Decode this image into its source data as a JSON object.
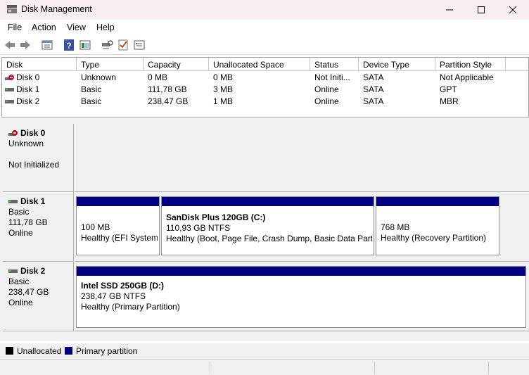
{
  "window": {
    "title": "Disk Management"
  },
  "menu": [
    "File",
    "Action",
    "View",
    "Help"
  ],
  "toolbar": [
    "back-icon",
    "forward-icon",
    "properties-icon",
    "help-icon",
    "view-icon",
    "rescan-icon",
    "check-icon",
    "settings-icon"
  ],
  "list": {
    "columns": [
      "Disk",
      "Type",
      "Capacity",
      "Unallocated Space",
      "Status",
      "Device Type",
      "Partition Style"
    ],
    "rows": [
      {
        "disk": "Disk 0",
        "type": "Unknown",
        "capacity": "0 MB",
        "unallocated": "0 MB",
        "status": "Not Initi...",
        "device": "SATA",
        "style": "Not Applicable",
        "icon": "disk-error-icon"
      },
      {
        "disk": "Disk 1",
        "type": "Basic",
        "capacity": "111,78 GB",
        "unallocated": "3 MB",
        "status": "Online",
        "device": "SATA",
        "style": "GPT",
        "icon": "disk-icon"
      },
      {
        "disk": "Disk 2",
        "type": "Basic",
        "capacity": "238,47 GB",
        "unallocated": "1 MB",
        "status": "Online",
        "device": "SATA",
        "style": "MBR",
        "icon": "disk-icon"
      }
    ]
  },
  "disks": [
    {
      "name": "Disk 0",
      "lines": [
        "Unknown",
        "",
        "Not Initialized"
      ],
      "partitions": []
    },
    {
      "name": "Disk 1",
      "lines": [
        "Basic",
        "111,78 GB",
        "Online"
      ],
      "partitions": [
        {
          "title": "",
          "size": "100 MB",
          "status": "Healthy (EFI System"
        },
        {
          "title": "SanDisk Plus 120GB  (C:)",
          "size": "110,93 GB NTFS",
          "status": "Healthy (Boot, Page File, Crash Dump, Basic Data Partit"
        },
        {
          "title": "",
          "size": "768 MB",
          "status": "Healthy (Recovery Partition)"
        }
      ]
    },
    {
      "name": "Disk 2",
      "lines": [
        "Basic",
        "238,47 GB",
        "Online"
      ],
      "partitions": [
        {
          "title": "Intel SSD 250GB  (D:)",
          "size": "238,47 GB NTFS",
          "status": "Healthy (Primary Partition)"
        }
      ]
    }
  ],
  "legend": [
    {
      "label": "Unallocated",
      "color": "#000000"
    },
    {
      "label": "Primary partition",
      "color": "#000080"
    }
  ],
  "colors": {
    "primary": "#000080",
    "titlebar": "#f9eef2"
  }
}
